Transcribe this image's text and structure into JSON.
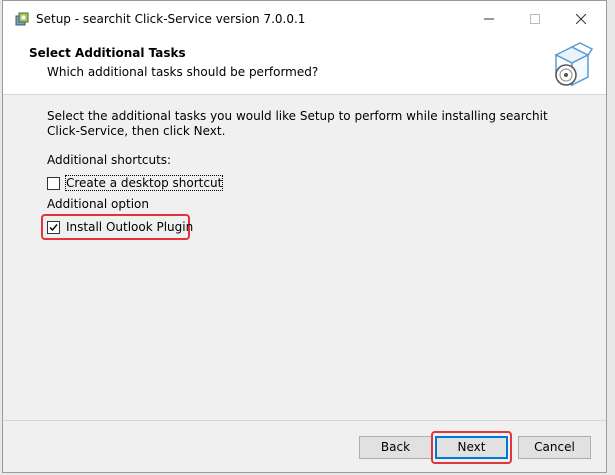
{
  "window": {
    "title": "Setup - searchit Click-Service version 7.0.0.1"
  },
  "header": {
    "title": "Select Additional Tasks",
    "subtitle": "Which additional tasks should be performed?"
  },
  "main": {
    "instructions": "Select the additional tasks you would like Setup to perform while installing searchit Click-Service, then click Next.",
    "sections": [
      {
        "label": "Additional shortcuts:",
        "option": {
          "label": "Create a desktop shortcut",
          "checked": false
        }
      },
      {
        "label": "Additional option",
        "option": {
          "label": "Install Outlook Plugin",
          "checked": true
        }
      }
    ]
  },
  "buttons": {
    "back": "Back",
    "next": "Next",
    "cancel": "Cancel"
  },
  "colors": {
    "highlight": "#e0343e",
    "accent": "#0078d7",
    "window_bg": "#f0f0f0"
  },
  "icons": {
    "app": "setup-app-icon",
    "header": "install-box-cd-icon"
  }
}
